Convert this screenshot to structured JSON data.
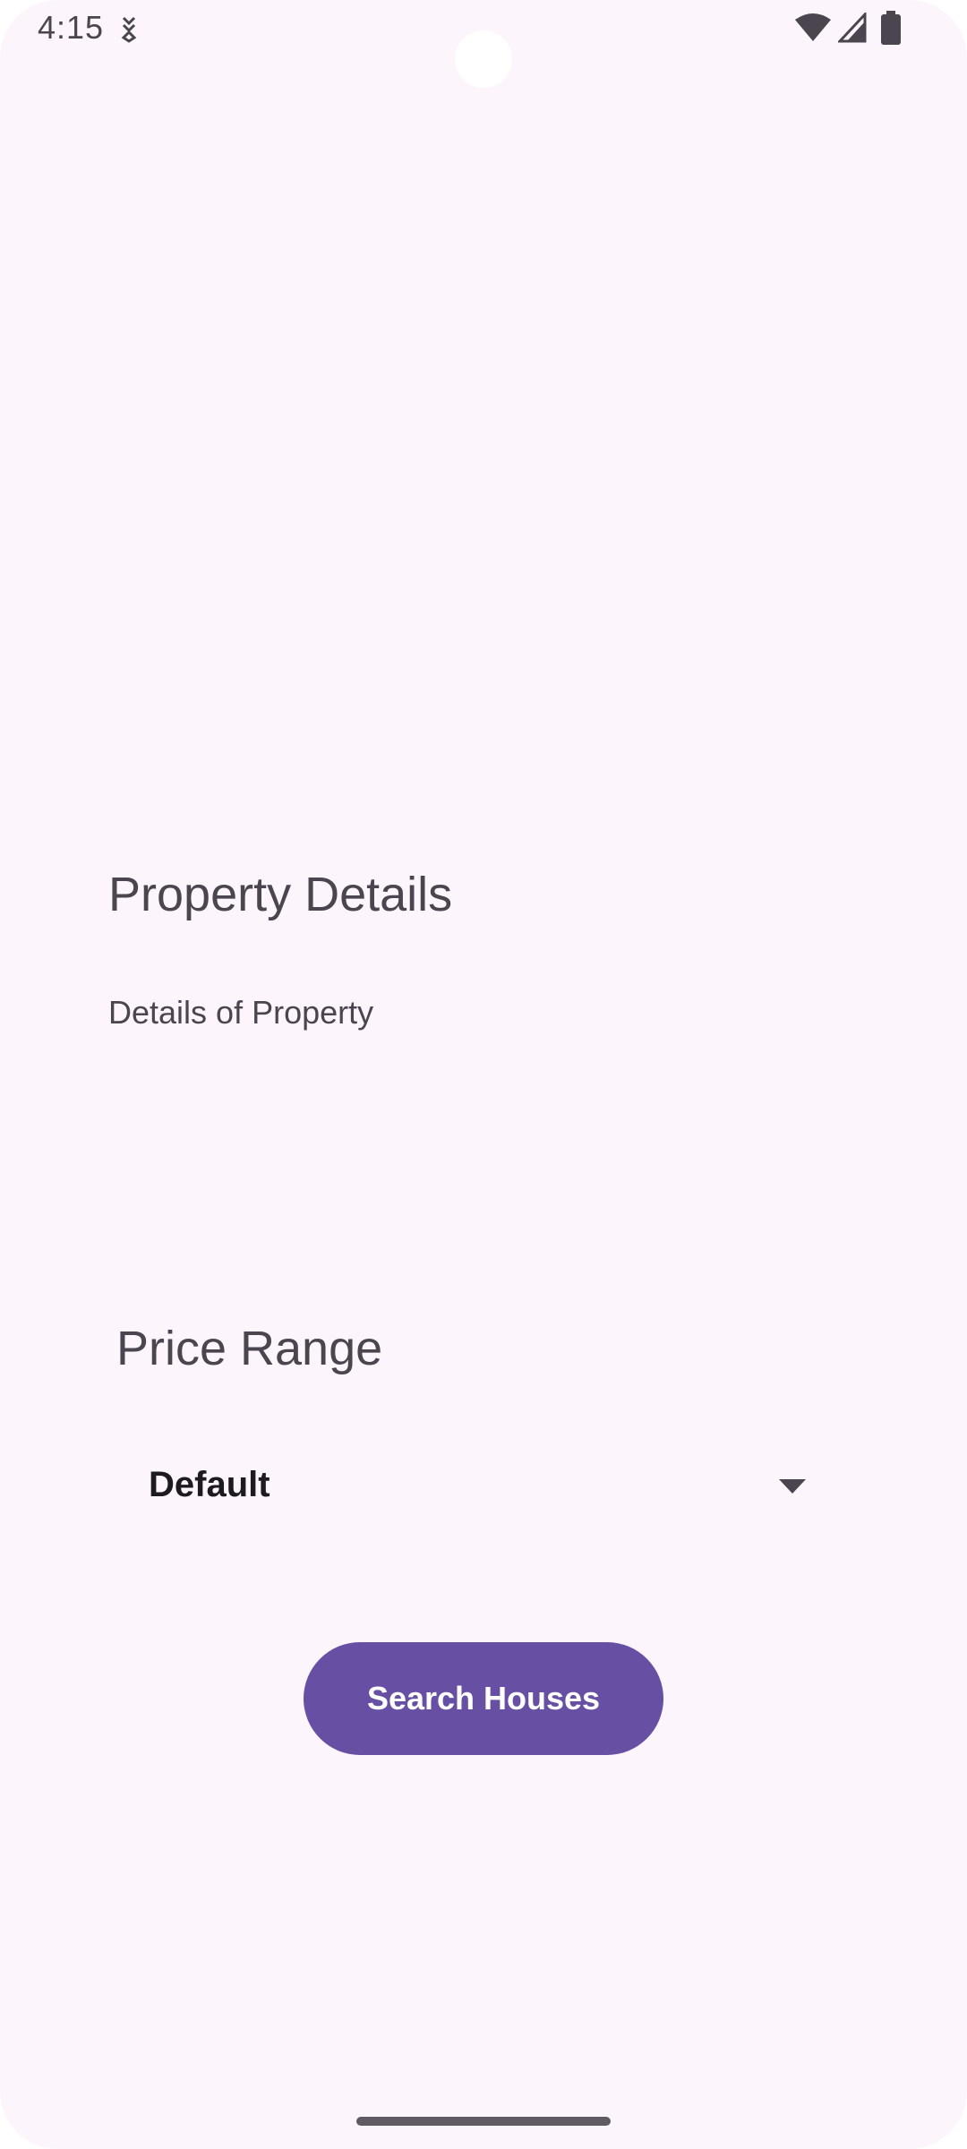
{
  "status_bar": {
    "time": "4:15",
    "app_icon": "download-indicator-icon",
    "icons": [
      "wifi-icon",
      "signal-icon",
      "battery-icon"
    ]
  },
  "property": {
    "title": "Property Details",
    "subtitle": "Details of Property"
  },
  "price_range": {
    "label": "Price Range",
    "selected": "Default"
  },
  "search_button": {
    "label": "Search Houses"
  },
  "colors": {
    "background": "#fcf6fc",
    "primary": "#6750a4",
    "text": "#4a454e",
    "on_primary": "#ffffff"
  }
}
